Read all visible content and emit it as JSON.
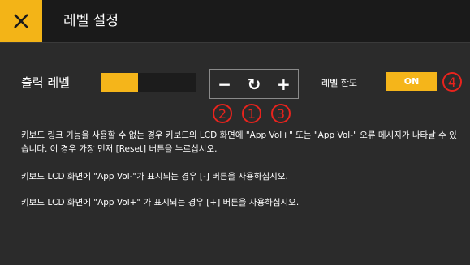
{
  "header": {
    "title": "레벨 설정"
  },
  "output": {
    "label": "출력 레벨",
    "level_fraction": 0.39
  },
  "controls": {
    "minus_label": "−",
    "reset_label": "↻",
    "plus_label": "+"
  },
  "limit": {
    "label": "레벨 한도",
    "toggle_value": "ON"
  },
  "markers": {
    "m1": "1",
    "m2": "2",
    "m3": "3",
    "m4": "4"
  },
  "messages": {
    "line1": "키보드 링크 기능을 사용할 수 없는 경우 키보드의 LCD 화면에 \"App Vol+\" 또는 \"App Vol-\" 오류 메시지가 나타날 수 있습니다. 이 경우 가장 먼저 [Reset] 버튼을 누르십시오.",
    "line2": "키보드 LCD 화면에 \"App Vol-\"가 표시되는 경우 [-] 버튼을 사용하십시오.",
    "line3": "키보드 LCD 화면에 \"App Vol+\" 가 표시되는 경우 [+] 버튼을 사용하십시오."
  },
  "colors": {
    "accent": "#f5b51a",
    "marker": "#e8231d",
    "background": "#2b2b2b"
  }
}
